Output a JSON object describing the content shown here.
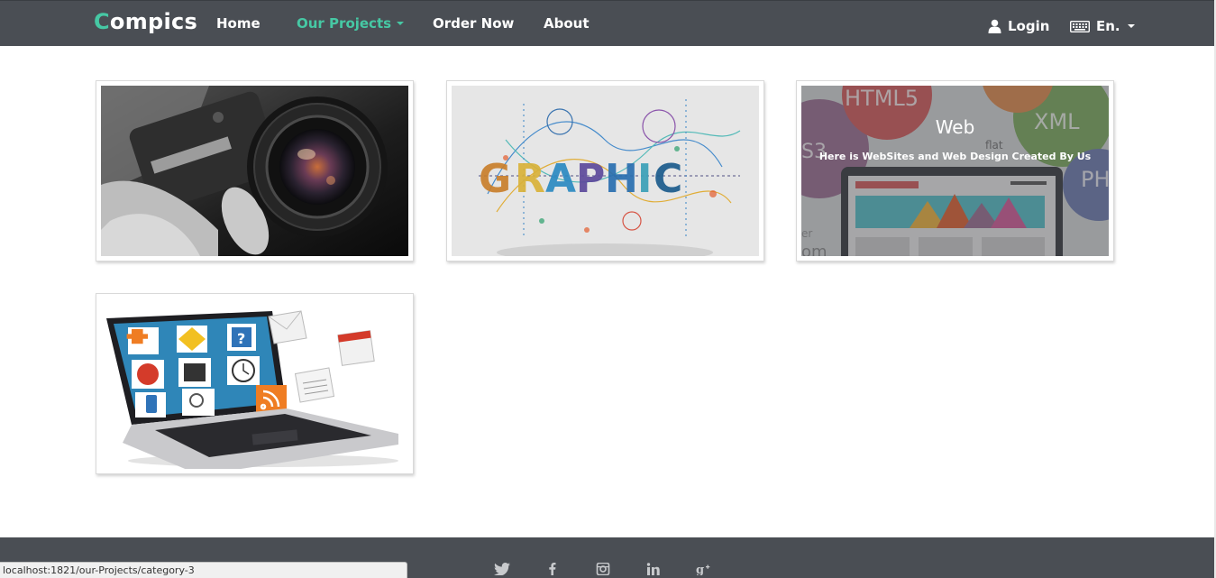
{
  "navbar": {
    "brand_first": "C",
    "brand_rest": "ompics",
    "links": [
      {
        "label": "Home"
      },
      {
        "label": "Our Projects",
        "has_dropdown": true,
        "active": true
      },
      {
        "label": "Order Now"
      },
      {
        "label": "About"
      }
    ],
    "login_label": "Login",
    "language_label": "En."
  },
  "gallery": {
    "cards": [
      {
        "icon": "camera-lens-photo",
        "title": "",
        "description": ""
      },
      {
        "icon": "graphic-art-typography",
        "title": "",
        "description": ""
      },
      {
        "icon": "web-design-collage",
        "title": "Web",
        "description": "Here is WebSites and Web Design Created By Us"
      },
      {
        "icon": "laptop-apps-illustration",
        "title": "",
        "description": ""
      }
    ]
  },
  "footer": {
    "social_icons": [
      "twitter-icon",
      "facebook-icon",
      "instagram-icon",
      "linkedin-icon",
      "google-plus-icon"
    ]
  },
  "status_bar": {
    "url": "localhost:1821/our-Projects/category-3"
  },
  "colors": {
    "navbar_bg": "#4a4e54",
    "accent": "#46c8a4",
    "footer_bg": "#4a4e54"
  }
}
